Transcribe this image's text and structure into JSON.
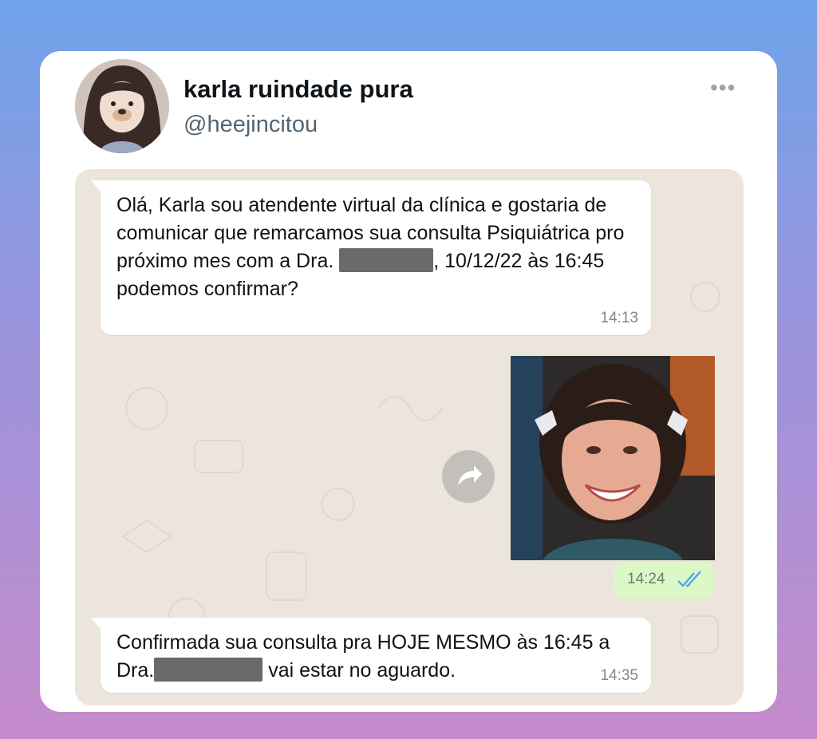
{
  "tweet": {
    "display_name": "karla ruindade pura",
    "handle": "@heejincitou",
    "more_icon": "more-horizontal-icon"
  },
  "chat": {
    "msg1": {
      "part1": "Olá, Karla sou atendente virtual da clínica e gostaria de comunicar que remarcamos sua consulta Psiquiátrica pro próximo mes com a Dra. ",
      "part2": ", 10/12/22 às 16:45 podemos confirmar?",
      "time": "14:13"
    },
    "media": {
      "time": "14:24",
      "status_icon": "double-check-read-icon",
      "forward_icon": "forward-arrow-icon"
    },
    "msg2": {
      "part1": "Confirmada sua consulta pra HOJE MESMO às 16:45 a Dra.",
      "part2": "vai estar no aguardo.",
      "time": "14:35"
    }
  }
}
